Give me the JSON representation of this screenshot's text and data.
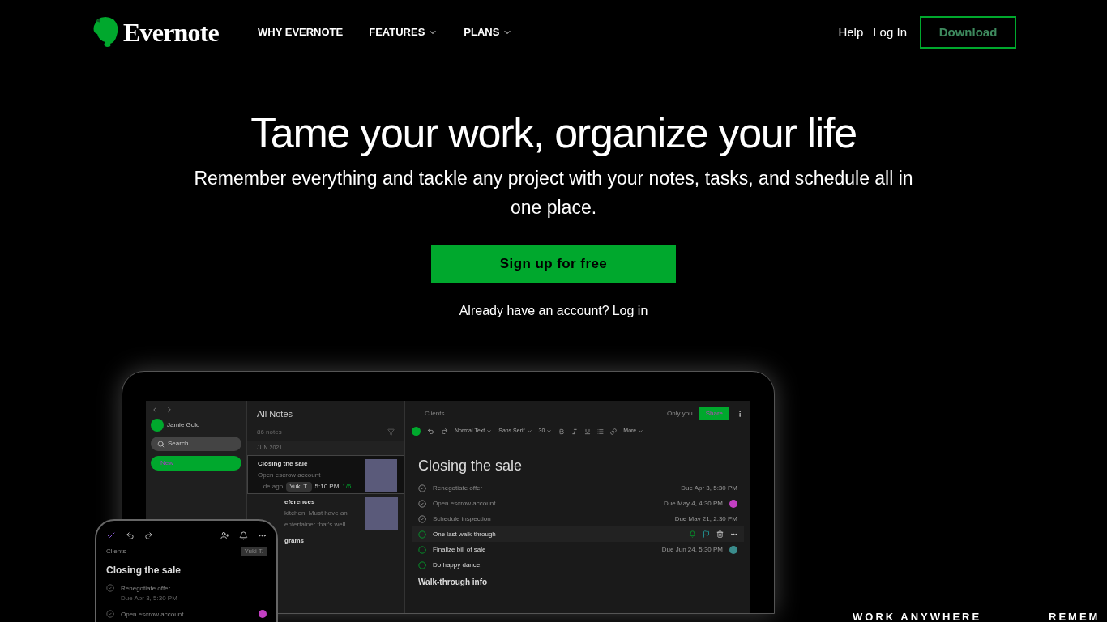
{
  "nav": {
    "logo": "Evernote",
    "links": [
      {
        "label": "WHY EVERNOTE",
        "dropdown": false
      },
      {
        "label": "FEATURES",
        "dropdown": true
      },
      {
        "label": "PLANS",
        "dropdown": true
      }
    ],
    "help": "Help",
    "login": "Log In",
    "download": "Download"
  },
  "hero": {
    "title": "Tame your work, organize your life",
    "subtitle": "Remember everything and tackle any project with your notes, tasks, and schedule all in one place.",
    "cta": "Sign up for free",
    "prompt": "Already have an account?",
    "prompt_link": "Log in"
  },
  "app": {
    "sidebar": {
      "user": "Jamie Gold",
      "search": "Search",
      "new": "New"
    },
    "notes": {
      "title": "All Notes",
      "count": "86 notes",
      "group": "JUN 2021",
      "items": [
        {
          "title": "Closing the sale",
          "snippet": "Open escrow account",
          "time": "...de ago",
          "tag": "Yuki T.",
          "meta": "5:10 PM",
          "progress": "1/6",
          "selected": true,
          "clipped": false
        },
        {
          "title": "eferences",
          "snippet": "kitchen. Must have an",
          "time": "entertainer that's well ...",
          "selected": false,
          "clipped": true
        },
        {
          "title": "grams",
          "selected": false,
          "clipped": true
        }
      ]
    },
    "editor": {
      "breadcrumb": "Clients",
      "visibility": "Only you",
      "share": "Share",
      "toolbar": [
        "Normal Text",
        "Sans Serif",
        "30",
        "More"
      ],
      "title": "Closing the sale",
      "tasks": [
        {
          "text": "Renegotiate offer",
          "done": true,
          "due": "Due Apr 3, 5:30 PM",
          "active": false
        },
        {
          "text": "Open escrow account",
          "done": true,
          "due": "Due May 4, 4:30 PM",
          "color": "#c23fc2",
          "active": false
        },
        {
          "text": "Schedule inspection",
          "done": true,
          "due": "Due May 21, 2:30 PM",
          "active": false
        },
        {
          "text": "One last walk-through",
          "done": false,
          "active": true
        },
        {
          "text": "Finalize bill of sale",
          "done": false,
          "due": "Due Jun 24, 5:30 PM",
          "color": "#3a8c8c",
          "active": false
        },
        {
          "text": "Do happy dance!",
          "done": false,
          "active": false
        }
      ],
      "heading": "Walk-through info"
    }
  },
  "phone": {
    "breadcrumb": "Clients",
    "tag": "Yuki T.",
    "title": "Closing the sale",
    "tasks": [
      {
        "text": "Renegotiate offer",
        "due": "Due Apr 3, 5:30 PM",
        "done": true
      },
      {
        "text": "Open escrow account",
        "done": true,
        "color": "#c23fc2"
      }
    ]
  },
  "footer": {
    "left": "WORK ANYWHERE",
    "right": "REMEM"
  }
}
